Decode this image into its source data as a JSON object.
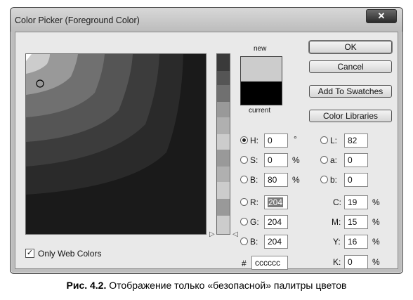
{
  "window": {
    "title": "Color Picker (Foreground Color)",
    "close_glyph": "✕"
  },
  "preview": {
    "new_label": "new",
    "current_label": "current",
    "new_color": "#cccccc",
    "current_color": "#000000"
  },
  "buttons": {
    "ok": "OK",
    "cancel": "Cancel",
    "add_to_swatches": "Add To Swatches",
    "color_libraries": "Color Libraries"
  },
  "fields": {
    "h": {
      "label": "H:",
      "value": "0",
      "unit": "°"
    },
    "s": {
      "label": "S:",
      "value": "0",
      "unit": "%"
    },
    "b": {
      "label": "B:",
      "value": "80",
      "unit": "%"
    },
    "r": {
      "label": "R:",
      "value": "204"
    },
    "g": {
      "label": "G:",
      "value": "204"
    },
    "bl": {
      "label": "B:",
      "value": "204"
    },
    "l": {
      "label": "L:",
      "value": "82"
    },
    "a": {
      "label": "a:",
      "value": "0"
    },
    "lb": {
      "label": "b:",
      "value": "0"
    },
    "c": {
      "label": "C:",
      "value": "19",
      "unit": "%"
    },
    "m": {
      "label": "M:",
      "value": "15",
      "unit": "%"
    },
    "y": {
      "label": "Y:",
      "value": "16",
      "unit": "%"
    },
    "k": {
      "label": "K:",
      "value": "0",
      "unit": "%"
    },
    "hex": {
      "label": "#",
      "value": "cccccc"
    }
  },
  "only_web_colors": {
    "label": "Only Web Colors",
    "checked": true
  },
  "caption": {
    "bold": "Рис. 4.2.",
    "text": " Отображение только «безопасной» палитры цветов"
  }
}
